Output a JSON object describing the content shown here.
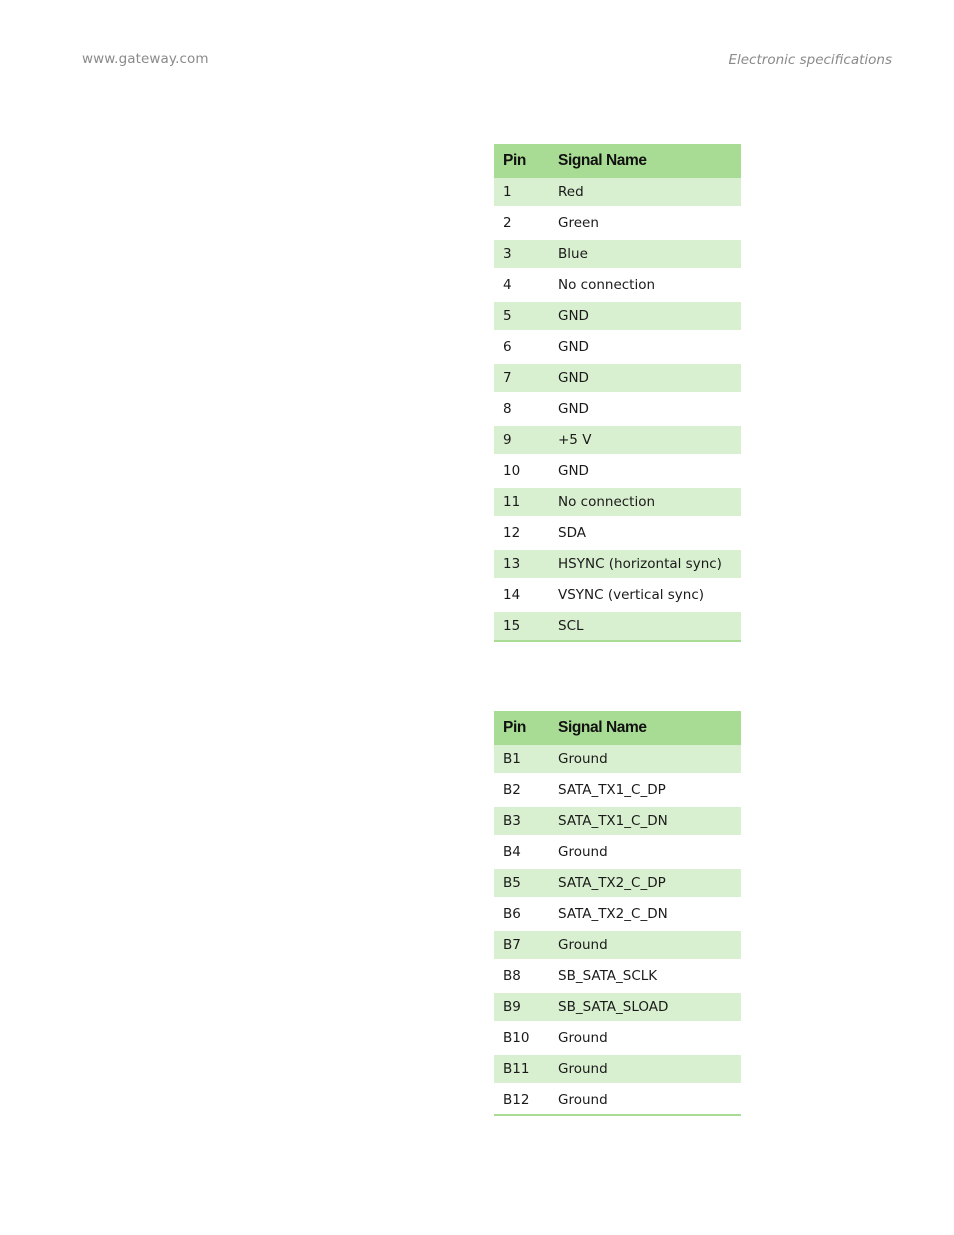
{
  "header": {
    "website": "www.gateway.com",
    "section": "Electronic specifications"
  },
  "tables": [
    {
      "columns": [
        "Pin",
        "Signal Name"
      ],
      "rows": [
        [
          "1",
          "Red"
        ],
        [
          "2",
          "Green"
        ],
        [
          "3",
          "Blue"
        ],
        [
          "4",
          "No connection"
        ],
        [
          "5",
          "GND"
        ],
        [
          "6",
          "GND"
        ],
        [
          "7",
          "GND"
        ],
        [
          "8",
          "GND"
        ],
        [
          "9",
          "+5 V"
        ],
        [
          "10",
          "GND"
        ],
        [
          "11",
          "No connection"
        ],
        [
          "12",
          "SDA"
        ],
        [
          "13",
          "HSYNC (horizontal sync)"
        ],
        [
          "14",
          "VSYNC (vertical sync)"
        ],
        [
          "15",
          "SCL"
        ]
      ]
    },
    {
      "columns": [
        "Pin",
        "Signal Name"
      ],
      "rows": [
        [
          "B1",
          "Ground"
        ],
        [
          "B2",
          "SATA_TX1_C_DP"
        ],
        [
          "B3",
          "SATA_TX1_C_DN"
        ],
        [
          "B4",
          "Ground"
        ],
        [
          "B5",
          "SATA_TX2_C_DP"
        ],
        [
          "B6",
          "SATA_TX2_C_DN"
        ],
        [
          "B7",
          "Ground"
        ],
        [
          "B8",
          "SB_SATA_SCLK"
        ],
        [
          "B9",
          "SB_SATA_SLOAD"
        ],
        [
          "B10",
          "Ground"
        ],
        [
          "B11",
          "Ground"
        ],
        [
          "B12",
          "Ground"
        ]
      ]
    }
  ],
  "colors": {
    "header_bg": "#a8dc94",
    "stripe_bg": "#d9f0d0",
    "running_header_text": "#8a8a8a"
  }
}
